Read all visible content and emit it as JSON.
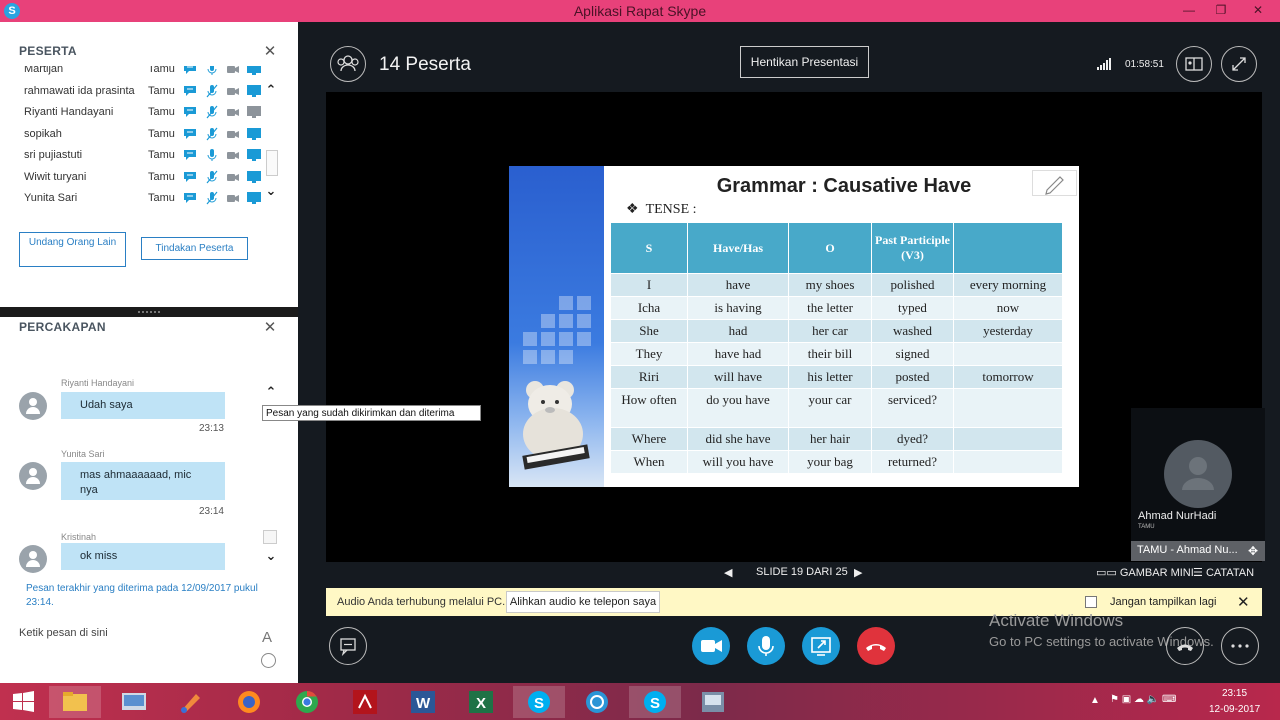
{
  "window": {
    "title": "Aplikasi Rapat Skype"
  },
  "participants_panel": {
    "title": "PESERTA",
    "people": [
      {
        "name": "Martijan",
        "role": "Tamu",
        "mic": "on",
        "screen": "blue"
      },
      {
        "name": "rahmawati ida prasinta",
        "role": "Tamu",
        "mic": "muted",
        "screen": "blue"
      },
      {
        "name": "Riyanti Handayani",
        "role": "Tamu",
        "mic": "muted",
        "screen": "gray"
      },
      {
        "name": "sopikah",
        "role": "Tamu",
        "mic": "muted",
        "screen": "blue"
      },
      {
        "name": "sri pujiastuti",
        "role": "Tamu",
        "mic": "on",
        "screen": "blue"
      },
      {
        "name": "Wiwit turyani",
        "role": "Tamu",
        "mic": "muted",
        "screen": "blue"
      },
      {
        "name": "Yunita Sari",
        "role": "Tamu",
        "mic": "muted",
        "screen": "blue"
      }
    ],
    "invite_label": "Undang Orang Lain",
    "actions_label": "Tindakan Peserta"
  },
  "conversation_panel": {
    "title": "PERCAKAPAN",
    "messages": [
      {
        "sender": "Riyanti Handayani",
        "text": "Udah saya",
        "time": "23:13"
      },
      {
        "sender": "Yunita Sari",
        "text": "mas ahmaaaaaad, mic nya",
        "time": "23:14"
      },
      {
        "sender": "Kristinah",
        "text": "ok miss",
        "time": ""
      }
    ],
    "tooltip": "Pesan yang sudah dikirimkan dan diterima",
    "last_message_note": "Pesan terakhir yang diterima pada 12/09/2017 pukul 23:14.",
    "compose_placeholder": "Ketik pesan di sini",
    "format_label": "A"
  },
  "meeting": {
    "participant_count": "14 Peserta",
    "stop_presenting": "Hentikan Presentasi",
    "duration": "01:58:51"
  },
  "slide": {
    "title": "Grammar : Causative Have",
    "tense_label": "TENSE :",
    "bullet": "❖",
    "headers": [
      "S",
      "Have/Has",
      "O",
      "Past Participle (V3)",
      ""
    ],
    "rows": [
      [
        "I",
        "have",
        "my shoes",
        "polished",
        "every morning"
      ],
      [
        "Icha",
        "is having",
        "the letter",
        "typed",
        "now"
      ],
      [
        "She",
        "had",
        "her car",
        "washed",
        "yesterday"
      ],
      [
        "They",
        "have had",
        "their bill",
        "signed",
        ""
      ],
      [
        "Riri",
        "will have",
        "his letter",
        "posted",
        "tomorrow"
      ],
      [
        "How often",
        "do you have",
        "your car",
        "serviced?",
        ""
      ],
      [
        "Where",
        "did she have",
        "her hair",
        "dyed?",
        ""
      ],
      [
        "When",
        "will you have",
        "your bag",
        "returned?",
        ""
      ]
    ],
    "counter": "SLIDE 19 DARI 25"
  },
  "video": {
    "name": "Ahmad NurHadi",
    "role": "TAMU",
    "label": "TAMU - Ahmad Nu..."
  },
  "view_controls": {
    "thumbnails": "GAMBAR MINI",
    "notes": "CATATAN"
  },
  "audio_bar": {
    "message": "Audio Anda terhubung melalui PC.",
    "switch_label": "Alihkan audio ke telepon saya",
    "dont_show": "Jangan tampilkan lagi"
  },
  "watermark": {
    "line1": "Activate Windows",
    "line2": "Go to PC settings to activate Windows."
  },
  "taskbar": {
    "time": "23:15",
    "date": "12-09-2017"
  },
  "colors": {
    "title_bar": "#e8417a",
    "accent_blue": "#1a9ad6",
    "hangup_red": "#e0333c",
    "table_header": "#48a9c9",
    "link_blue": "#2a7fc4"
  }
}
